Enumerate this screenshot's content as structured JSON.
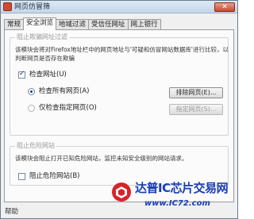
{
  "window": {
    "title": "网页仿冒筛",
    "close_label": "✕"
  },
  "tabs": [
    {
      "label": "常规",
      "active": false
    },
    {
      "label": "安全浏览",
      "active": true
    },
    {
      "label": "地域过滤",
      "active": false
    },
    {
      "label": "受信任网址",
      "active": false
    },
    {
      "label": "网上银行",
      "active": false
    }
  ],
  "phishing_group": {
    "legend": "阻止欺骗网址过滤",
    "description_line1": "该模块会将对Firefox地址栏中的网页地址与'可疑和仿冒网站数据库'进行比较，以",
    "description_line2": "判断网页是否存在欺骗",
    "check_url_label": "检查网址(U)",
    "check_url_checked": true,
    "radio_all_label": "检查所有网页(A)",
    "radio_all_checked": true,
    "radio_blacklist_label": "仅检查指定网页(O)",
    "radio_blacklist_checked": false,
    "exclude_button": "排除网页(E)...",
    "specify_button": "指定网页(S)..."
  },
  "dangerous_group": {
    "legend": "阻止危险网站",
    "description": "该模块会阻止打开已知危险网站，监控未知安全级别的网站请求。",
    "block_label": "阻止危险网站(B)",
    "block_checked": false
  },
  "status": {
    "help": "帮助"
  },
  "watermark": {
    "title": "达普IC芯片交易网",
    "url": "www.IC72.com"
  },
  "colors": {
    "accent": "#1a3db8",
    "logo_red": "#d8232a",
    "title_icon": "#d04a32"
  }
}
